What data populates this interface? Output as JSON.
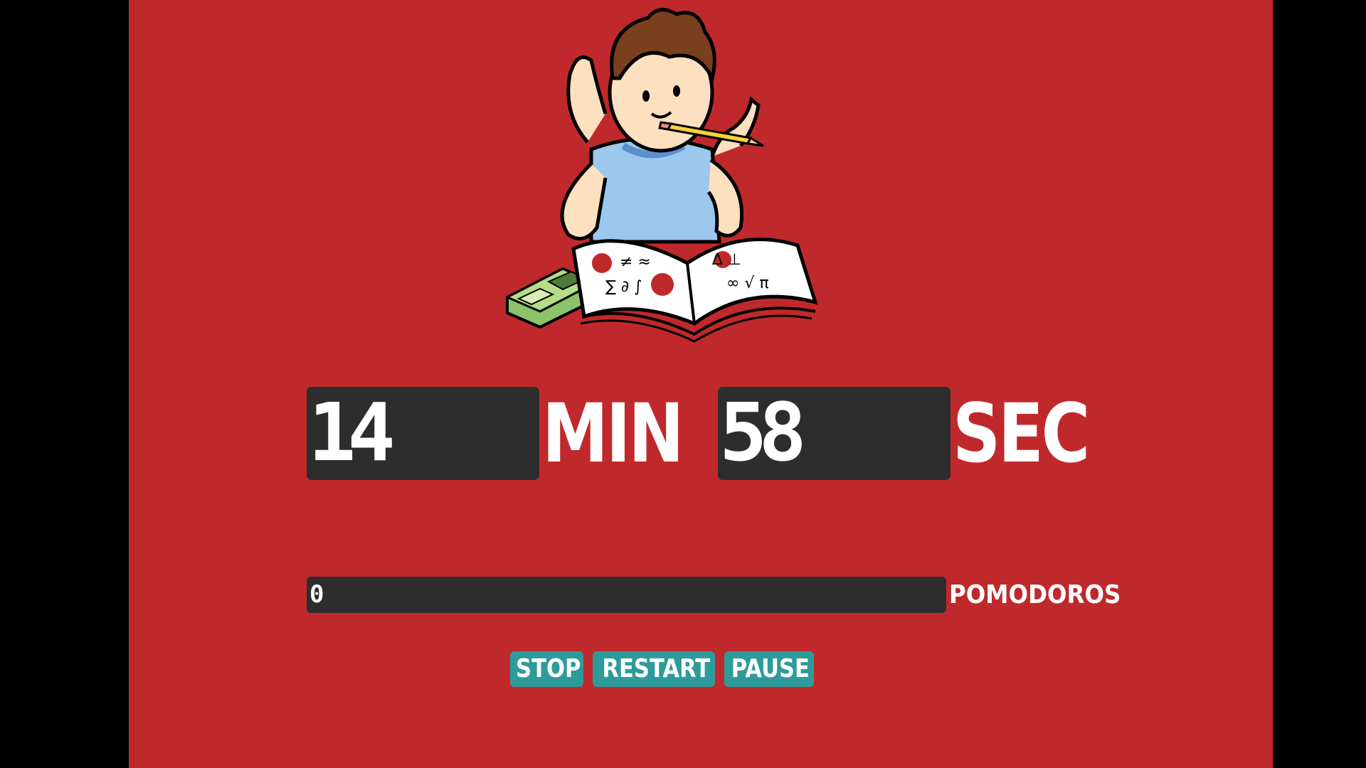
{
  "timer": {
    "minutes": "14",
    "minutes_label": "MIN",
    "seconds": "58",
    "seconds_label": "SEC"
  },
  "pomodoros": {
    "count": "0",
    "label": "POMODOROS"
  },
  "controls": {
    "stop_label": "STOP",
    "restart_label": "RESTART",
    "pause_label": "PAUSE"
  },
  "illustration": {
    "icon": "student-studying-illustration"
  },
  "colors": {
    "background": "#c0292b",
    "panel": "#2d2d2d",
    "button": "#2e9b9b",
    "text": "#ffffff"
  }
}
